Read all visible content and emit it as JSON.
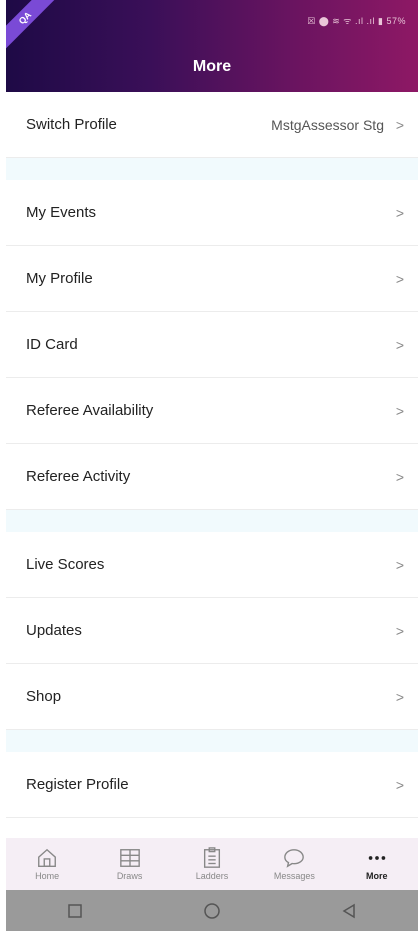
{
  "header": {
    "title": "More",
    "ribbon": "QA",
    "status": "☒ ⬤ ≋ ᯤ .ıl .ıl ▮ 57%"
  },
  "menu": {
    "switch_profile": {
      "label": "Switch Profile",
      "value": "MstgAssessor Stg"
    },
    "group1": [
      {
        "label": "My Events"
      },
      {
        "label": "My Profile"
      },
      {
        "label": "ID Card"
      },
      {
        "label": "Referee Availability"
      },
      {
        "label": "Referee Activity"
      }
    ],
    "group2": [
      {
        "label": "Live Scores"
      },
      {
        "label": "Updates"
      },
      {
        "label": "Shop"
      }
    ],
    "group3": [
      {
        "label": "Register Profile"
      }
    ],
    "chevron": ">"
  },
  "tabs": [
    {
      "label": "Home",
      "icon": "home-icon"
    },
    {
      "label": "Draws",
      "icon": "draws-icon"
    },
    {
      "label": "Ladders",
      "icon": "ladders-icon"
    },
    {
      "label": "Messages",
      "icon": "messages-icon"
    },
    {
      "label": "More",
      "icon": "more-icon",
      "active": true
    }
  ]
}
